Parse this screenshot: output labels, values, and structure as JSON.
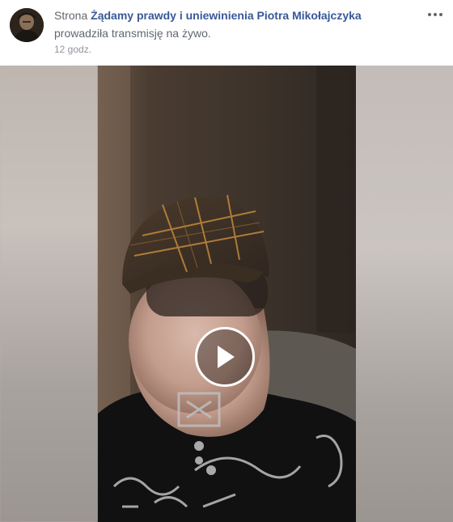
{
  "post": {
    "prefix": "Strona",
    "page_name": "Żądamy prawdy i uniewinienia Piotra Mikołajczyka",
    "action": "prowadziła transmisję na żywo.",
    "timestamp": "12 godz."
  },
  "icons": {
    "more": "more-options-icon",
    "play": "play-icon"
  },
  "colors": {
    "link": "#385898",
    "secondary_text": "#616770",
    "timestamp": "#90949c"
  }
}
